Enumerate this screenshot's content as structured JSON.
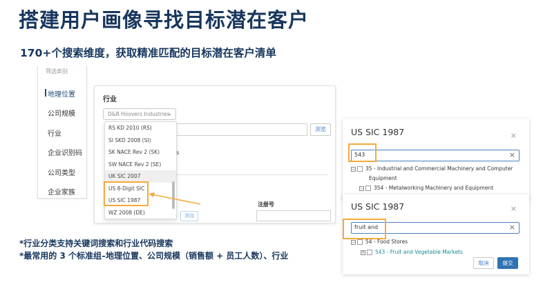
{
  "title": "搭建用户画像寻找目标潜在客户",
  "subtitle": "170+个搜索维度，获取精准匹配的目标潜在客户清单",
  "filter_panel": {
    "header": "筛选类别",
    "items": [
      {
        "label": "地理位置",
        "active": true
      },
      {
        "label": "公司规模",
        "active": false
      },
      {
        "label": "行业",
        "active": false
      },
      {
        "label": "企业识别码",
        "active": false
      },
      {
        "label": "公司类型",
        "active": false
      },
      {
        "label": "企业家族",
        "active": false
      }
    ]
  },
  "industry_panel": {
    "label": "行业",
    "select_value": "D&B Hoovers Industries",
    "search_button": "浏览",
    "stub_text": "s",
    "registration_label": "注册号",
    "add_button": "添加",
    "dropdown_options": [
      "RS KD 2010 (RS)",
      "SI SKD 2008 (SI)",
      "SK NACE Rev 2 (SK)",
      "SW NACE Rev 2 (SE)",
      "UK SIC 2007",
      "US 8-Digit SIC",
      "US SIC 1987",
      "WZ 2008 (DE)"
    ]
  },
  "sic_panel_1": {
    "title": "US SIC 1987",
    "close": "×",
    "search_value": "543",
    "clear": "×",
    "tree": [
      {
        "toggle": "−",
        "label": "35 - Industrial and Commercial Machinery and Computer",
        "continuation": "Equipment"
      },
      {
        "toggle": "−",
        "label": "354 - Metalworking Machinery and Equipment"
      }
    ]
  },
  "sic_panel_2": {
    "title": "US SIC 1987",
    "close": "×",
    "search_value": "fruit and",
    "clear": "×",
    "tree": [
      {
        "toggle": "−",
        "label": "54 - Food Stores"
      },
      {
        "toggle": "+",
        "label": "543 - Fruit and Vegetable Markets"
      }
    ],
    "cancel_button": "取消",
    "submit_button": "提交"
  },
  "notes": [
    "*行业分类支持关键词搜索和行业代码搜索",
    "*最常用的 3 个标准组–地理位置、公司规模（销售额 + 员工人数）、行业"
  ],
  "colors": {
    "title": "#17365d",
    "highlight_box": "#f5a93b",
    "accent_blue": "#2f73b3",
    "teal_link": "#1a8a93"
  }
}
